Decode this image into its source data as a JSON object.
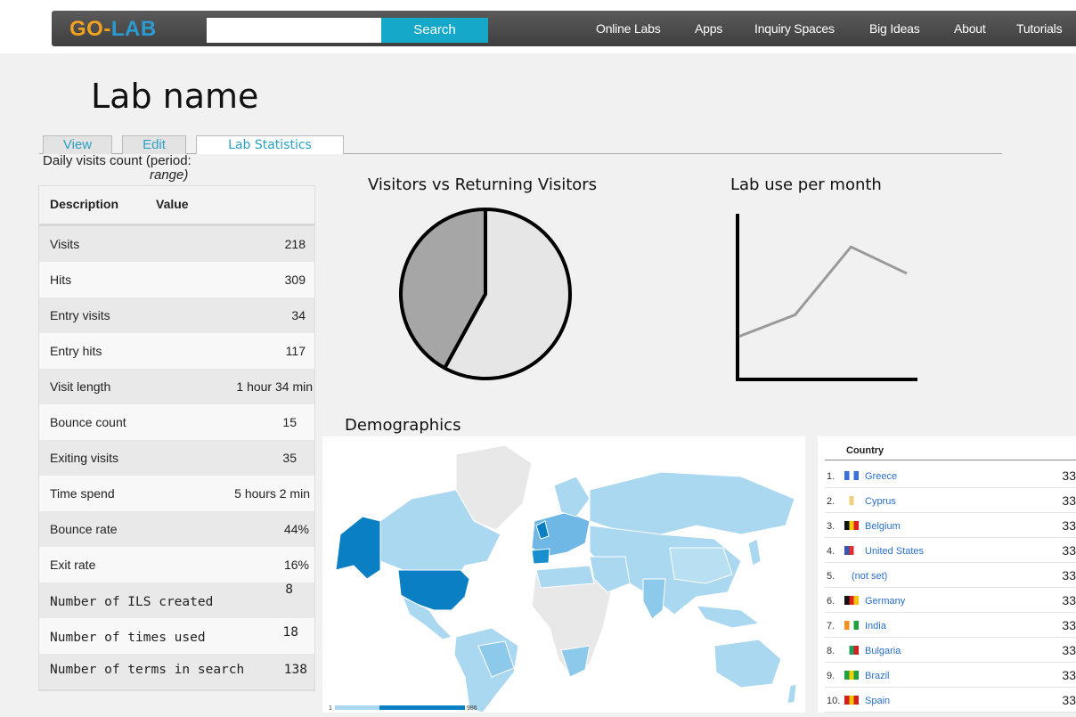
{
  "nav": {
    "logo_go": "GO",
    "logo_dash": "-",
    "logo_lab": "LAB",
    "search_placeholder": "",
    "search_label": "Search",
    "items": [
      "Online Labs",
      "Apps",
      "Inquiry Spaces",
      "Big Ideas",
      "About",
      "Tutorials"
    ]
  },
  "page": {
    "title": "Lab name",
    "tabs": [
      "View",
      "Edit",
      "Lab Statistics"
    ],
    "period_text": "Daily visits count (period:",
    "period_range": "range)"
  },
  "stats": {
    "col_description": "Description",
    "col_value": "Value",
    "rows": [
      {
        "label": "Visits",
        "value": "218"
      },
      {
        "label": "Hits",
        "value": "309"
      },
      {
        "label": "Entry visits",
        "value": "34"
      },
      {
        "label": "Entry hits",
        "value": "117"
      },
      {
        "label": "Visit length",
        "value": "1 hour 34 min"
      },
      {
        "label": "Bounce count",
        "value": "15"
      },
      {
        "label": "Exiting visits",
        "value": "35"
      },
      {
        "label": "Time spend",
        "value": "5 hours 2 min"
      },
      {
        "label": "Bounce rate",
        "value": "44%"
      },
      {
        "label": "Exit rate",
        "value": "16%"
      },
      {
        "label": "Number of ILS created",
        "value": "8"
      },
      {
        "label": "Number of times used",
        "value": "18"
      },
      {
        "label": "Number of terms in search",
        "value": "138"
      }
    ]
  },
  "charts": {
    "pie_title": "Visitors vs Returning Visitors",
    "line_title": "Lab use per month",
    "demographics_title": "Demographics",
    "map_scale_min": "1",
    "map_scale_max": "986"
  },
  "chart_data": [
    {
      "type": "pie",
      "title": "Visitors vs Returning Visitors",
      "slices": [
        {
          "value": 58,
          "color": "#e6e6e6"
        },
        {
          "value": 42,
          "color": "#a6a6a6"
        }
      ]
    },
    {
      "type": "line",
      "title": "Lab use per month",
      "x": [
        1,
        2,
        3,
        4
      ],
      "y": [
        26,
        39,
        80,
        64
      ],
      "ylim": [
        0,
        100
      ],
      "color": "#9a9a9a"
    }
  ],
  "countries": {
    "header": "Country",
    "rows": [
      {
        "num": "1.",
        "name": "Greece",
        "count": "33",
        "flag": [
          "#3a6fd6",
          "#ffffff",
          "#3a6fd6"
        ]
      },
      {
        "num": "2.",
        "name": "Cyprus",
        "count": "33",
        "flag": [
          "#ffffff",
          "#f0d080",
          "#ffffff"
        ]
      },
      {
        "num": "3.",
        "name": "Belgium",
        "count": "33",
        "flag": [
          "#111111",
          "#f5d000",
          "#e02020"
        ]
      },
      {
        "num": "4.",
        "name": "United States",
        "count": "33",
        "flag": [
          "#3a55b0",
          "#e03030",
          "#ffffff"
        ]
      },
      {
        "num": "5.",
        "name": "(not set)",
        "count": "33",
        "flag": []
      },
      {
        "num": "6.",
        "name": "Germany",
        "count": "33",
        "flag": [
          "#111111",
          "#e02020",
          "#f5c400"
        ]
      },
      {
        "num": "7.",
        "name": "India",
        "count": "33",
        "flag": [
          "#f09020",
          "#ffffff",
          "#20a040"
        ]
      },
      {
        "num": "8.",
        "name": "Bulgaria",
        "count": "33",
        "flag": [
          "#ffffff",
          "#20a060",
          "#d02020"
        ]
      },
      {
        "num": "9.",
        "name": "Brazil",
        "count": "33",
        "flag": [
          "#20a040",
          "#f5d000",
          "#20a040"
        ]
      },
      {
        "num": "10.",
        "name": "Spain",
        "count": "33",
        "flag": [
          "#d02020",
          "#f5c400",
          "#d02020"
        ]
      }
    ]
  },
  "colors": {
    "accent": "#16a8c8",
    "map_dark": "#0a7fc4",
    "map_light": "#a9d8f0"
  }
}
